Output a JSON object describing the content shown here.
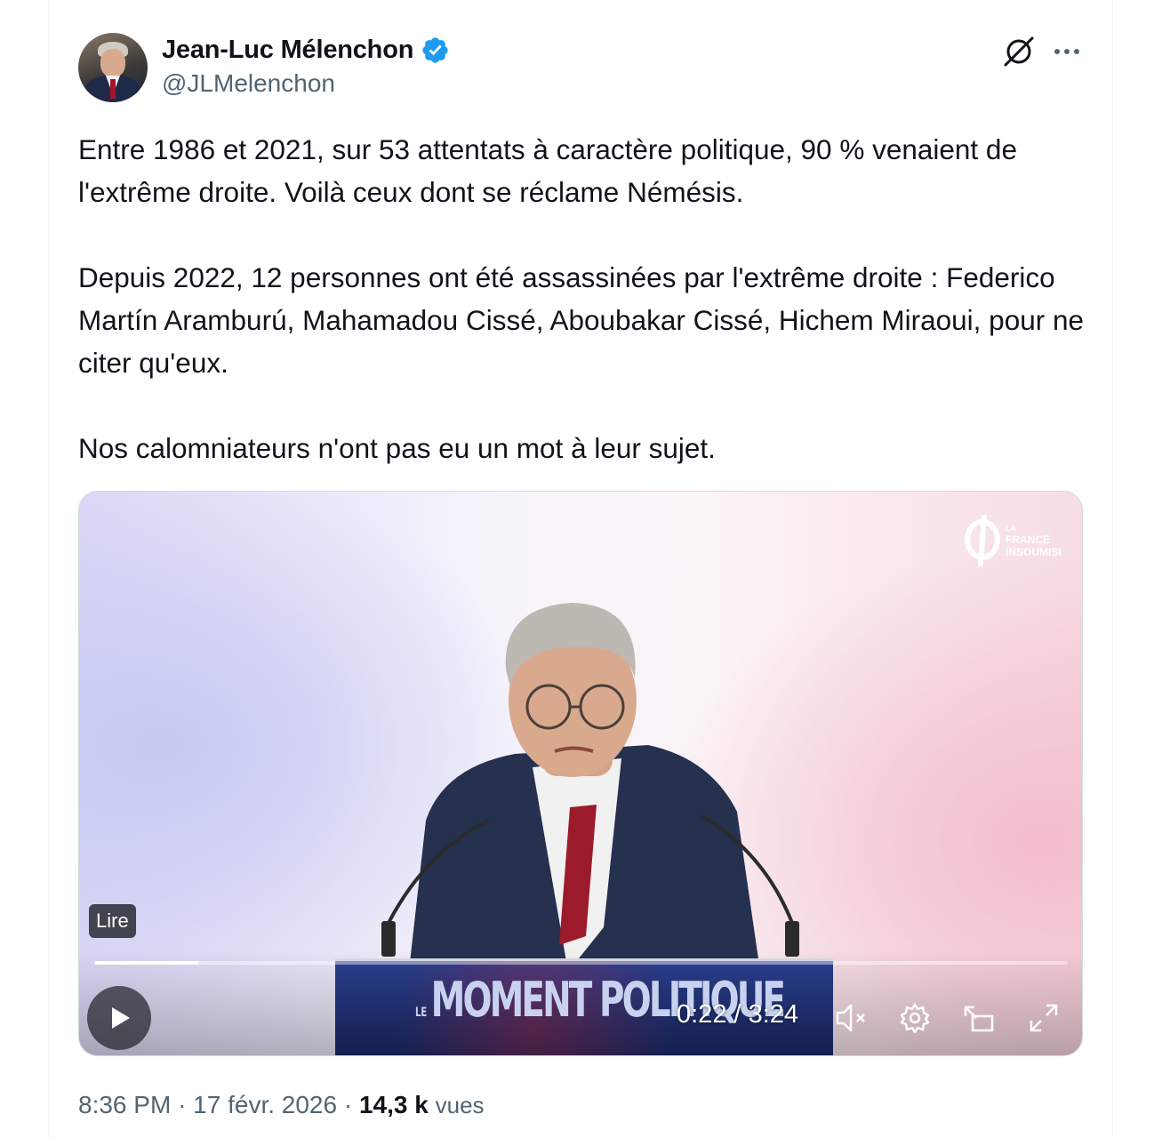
{
  "author": {
    "name": "Jean-Luc Mélenchon",
    "handle": "@JLMelenchon",
    "verified": true,
    "verified_color": "#1d9bf0"
  },
  "header_actions": {
    "grok_icon": "grok-icon",
    "more_icon": "more-icon"
  },
  "tweet": {
    "paragraph1": "Entre 1986 et 2021, sur 53 attentats à caractère politique, 90 % venaient de l'extrême droite. Voilà ceux dont se réclame Némésis.",
    "paragraph2": "Depuis 2022, 12 personnes ont été assassinées par l'extrême droite : Federico Martín Aramburú, Mahamadou Cissé, Aboubakar Cissé, Hichem Miraoui, pour ne citer qu'eux.",
    "paragraph3": "Nos calomniateurs n'ont pas eu un mot à leur sujet."
  },
  "video": {
    "lire_label": "Lire",
    "current_time": "0:22",
    "duration": "3:24",
    "time_display": "0:22 / 3:24",
    "progress_fraction": 0.108,
    "lectern_prefix": "LE",
    "lectern_title": "MOMENT POLITIQUE",
    "logo_line1": "LA",
    "logo_line2": "FRANCE",
    "logo_line3": "INSOUMISE"
  },
  "meta": {
    "time": "8:36 PM",
    "separator": "·",
    "date": "17 févr. 2026",
    "views_count": "14,3 k",
    "views_label": "vues"
  }
}
